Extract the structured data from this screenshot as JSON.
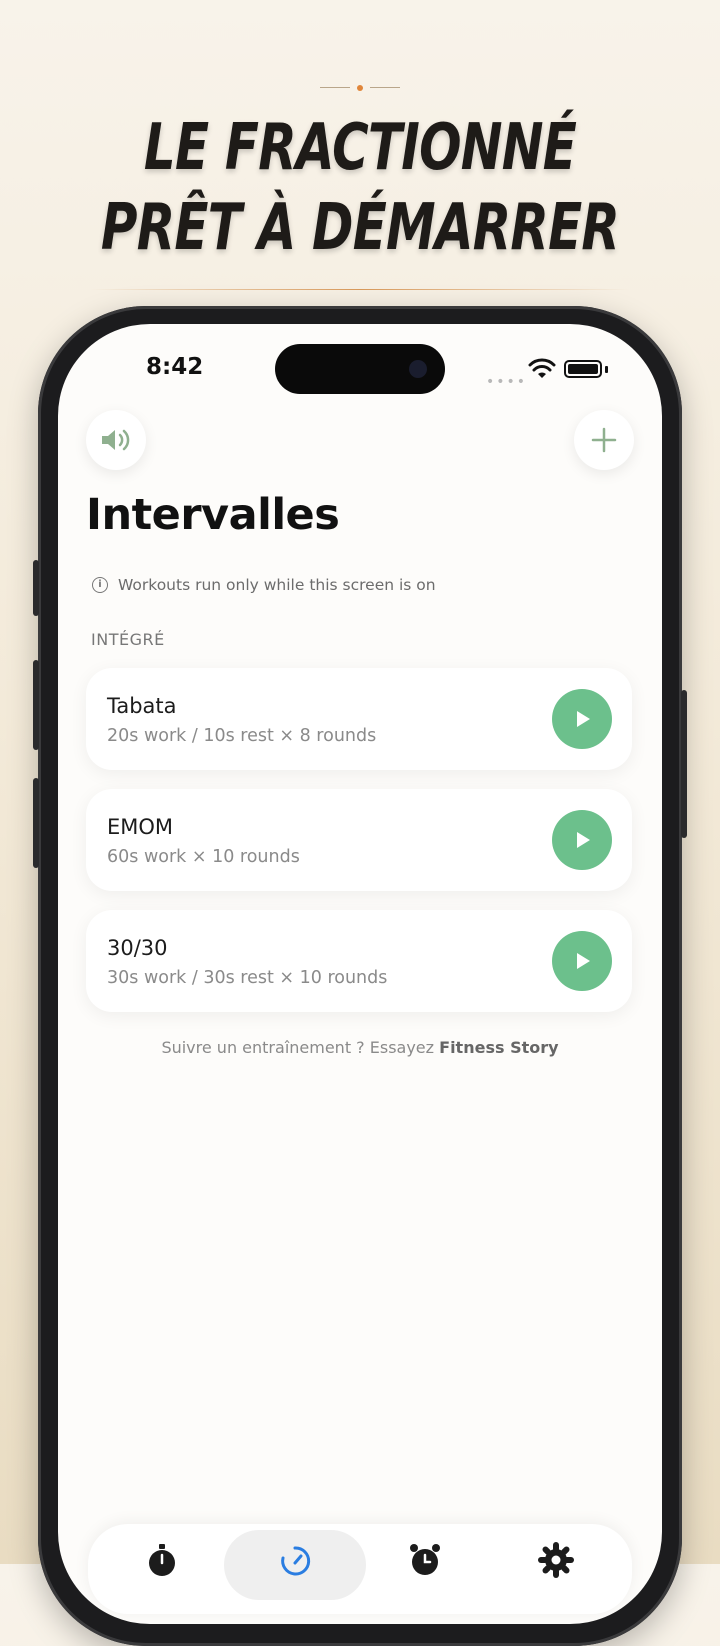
{
  "headline": {
    "line1": "LE FRACTIONNÉ",
    "line2": "PRÊT À DÉMARRER"
  },
  "status_bar": {
    "time": "8:42"
  },
  "page": {
    "title": "Intervalles",
    "info_text": "Workouts run only while this screen is on",
    "section_label": "INTÉGRÉ"
  },
  "workouts": [
    {
      "title": "Tabata",
      "subtitle": "20s work / 10s rest × 8 rounds"
    },
    {
      "title": "EMOM",
      "subtitle": "60s work × 10 rounds"
    },
    {
      "title": "30/30",
      "subtitle": "30s work / 30s rest × 10 rounds"
    }
  ],
  "footer": {
    "prefix": "Suivre un entraînement ? Essayez",
    "link": "Fitness Story"
  },
  "icons": {
    "sound": "speaker-icon",
    "add": "plus-icon",
    "play": "play-icon",
    "tabs": [
      "stopwatch-icon",
      "interval-timer-icon",
      "alarm-clock-icon",
      "gear-icon"
    ]
  },
  "colors": {
    "accent_green": "#6cc08c",
    "icon_green": "#8fb08f",
    "tab_active": "#2a7de1"
  }
}
